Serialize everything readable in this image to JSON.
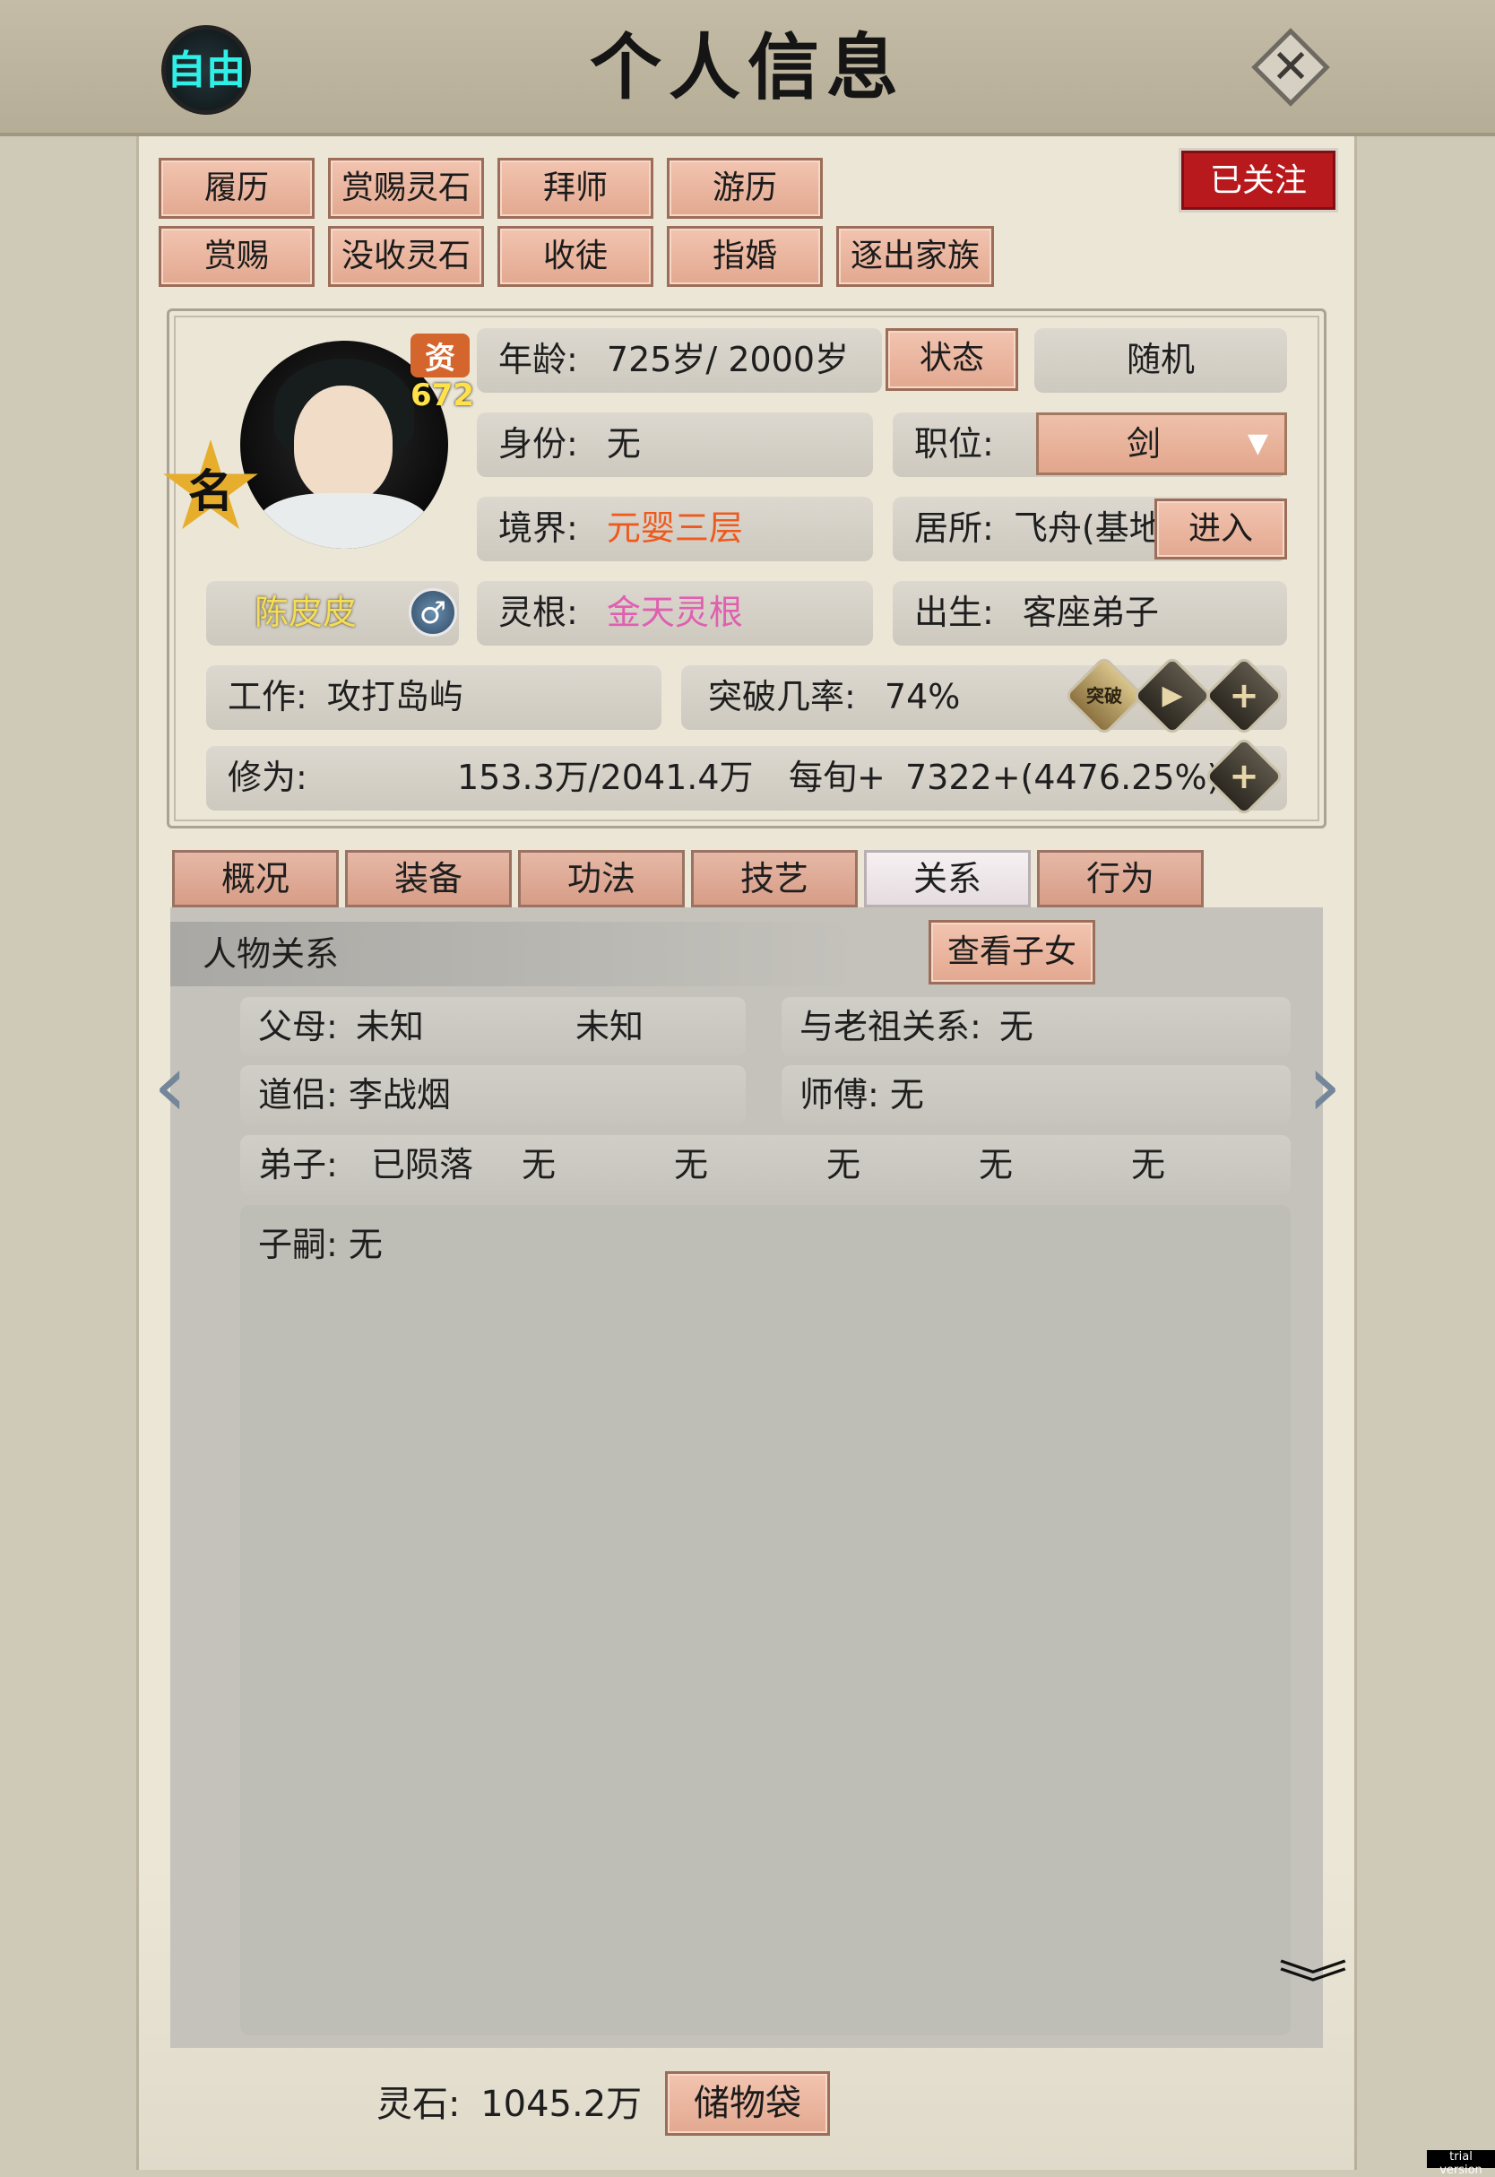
{
  "header": {
    "title": "个人信息",
    "free_label": "自由",
    "close_icon": "close-icon"
  },
  "actions_row1": [
    "履历",
    "赏赐灵石",
    "拜师",
    "游历"
  ],
  "actions_row2": [
    "赏赐",
    "没收灵石",
    "收徒",
    "指婚",
    "逐出家族"
  ],
  "followed_label": "已关注",
  "profile": {
    "talent_label": "资",
    "talent_value": "672",
    "badge_char": "名",
    "name": "陈皮皮",
    "gender_symbol": "♂",
    "age_label": "年龄:",
    "age_value": "725岁/ 2000岁",
    "status_button": "状态",
    "random_button": "随机",
    "identity_label": "身份:",
    "identity_value": "无",
    "position_label": "职位:",
    "position_value": "剑",
    "realm_label": "境界:",
    "realm_value": "元婴三层",
    "residence_label": "居所:",
    "residence_value": "飞舟(基地",
    "enter_button": "进入",
    "root_label": "灵根:",
    "root_value": "金天灵根",
    "birth_label": "出生:",
    "birth_value": "客座弟子",
    "work_label": "工作:",
    "work_value": "攻打岛屿",
    "breakthrough_label": "突破几率:",
    "breakthrough_value": "74%",
    "breakthrough_icon_text": "突破",
    "cultivation_label": "修为:",
    "cultivation_value": "153.3万/2041.4万",
    "per_turn_label": "每旬+",
    "per_turn_value": "7322+(4476.25%)"
  },
  "tabs": [
    {
      "label": "概况",
      "active": false
    },
    {
      "label": "装备",
      "active": false
    },
    {
      "label": "功法",
      "active": false
    },
    {
      "label": "技艺",
      "active": false
    },
    {
      "label": "关系",
      "active": true
    },
    {
      "label": "行为",
      "active": false
    }
  ],
  "relations": {
    "header": "人物关系",
    "view_children_button": "查看子女",
    "parents_label": "父母:",
    "parent1": "未知",
    "parent2": "未知",
    "ancestor_label": "与老祖关系:",
    "ancestor_value": "无",
    "partner_label": "道侣:",
    "partner_value": "李战烟",
    "master_label": "师傅:",
    "master_value": "无",
    "disciples_label": "弟子:",
    "disciples": [
      "已陨落",
      "无",
      "无",
      "无",
      "无",
      "无"
    ],
    "heirs_label": "子嗣:",
    "heirs_value": "无"
  },
  "footer": {
    "spirit_stone_label": "灵石:",
    "spirit_stone_value": "1045.2万",
    "storage_button": "储物袋"
  },
  "trial_label": "trial version",
  "colors": {
    "realm": "#ee5a1e",
    "root": "#e05fb0",
    "name": "#f4dd57",
    "accent_button": "#e3a890",
    "followed": "#b8191d"
  }
}
